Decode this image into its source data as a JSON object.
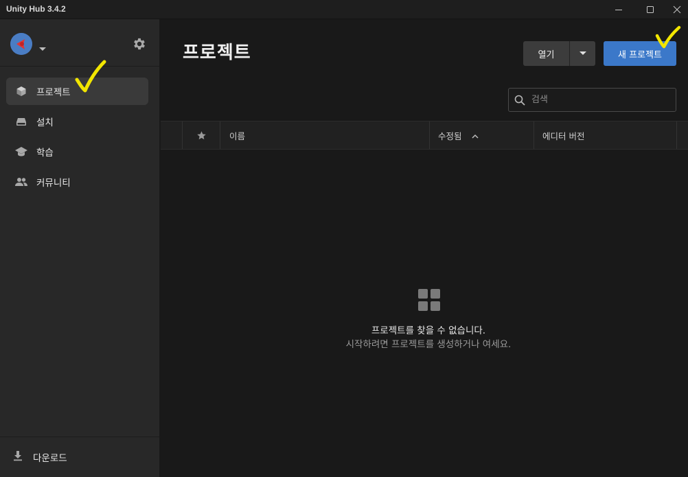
{
  "window": {
    "title": "Unity Hub 3.4.2",
    "controls": [
      "minimize-icon",
      "maximize-icon",
      "close-icon"
    ]
  },
  "sidebar": {
    "avatar": "user-avatar",
    "settings_icon": "gear-icon",
    "items": [
      {
        "label": "프로젝트",
        "icon": "cube-icon",
        "active": true
      },
      {
        "label": "설치",
        "icon": "drive-icon",
        "active": false
      },
      {
        "label": "학습",
        "icon": "graduation-cap-icon",
        "active": false
      },
      {
        "label": "커뮤니티",
        "icon": "people-icon",
        "active": false
      }
    ],
    "download_label": "다운로드"
  },
  "main": {
    "title": "프로젝트",
    "open_button": "열기",
    "new_project_button": "새 프로젝트",
    "search_placeholder": "검색",
    "columns": {
      "name": "이름",
      "modified": "수정됨",
      "editor_version": "에디터 버전"
    },
    "empty_title": "프로젝트를 찾을 수 없습니다.",
    "empty_subtitle": "시작하려면 프로젝트를 생성하거나 여세요."
  },
  "colors": {
    "accent": "#3b78c9",
    "annotation": "#f2e600",
    "sidebar_bg": "#282828",
    "main_bg": "#191919"
  }
}
